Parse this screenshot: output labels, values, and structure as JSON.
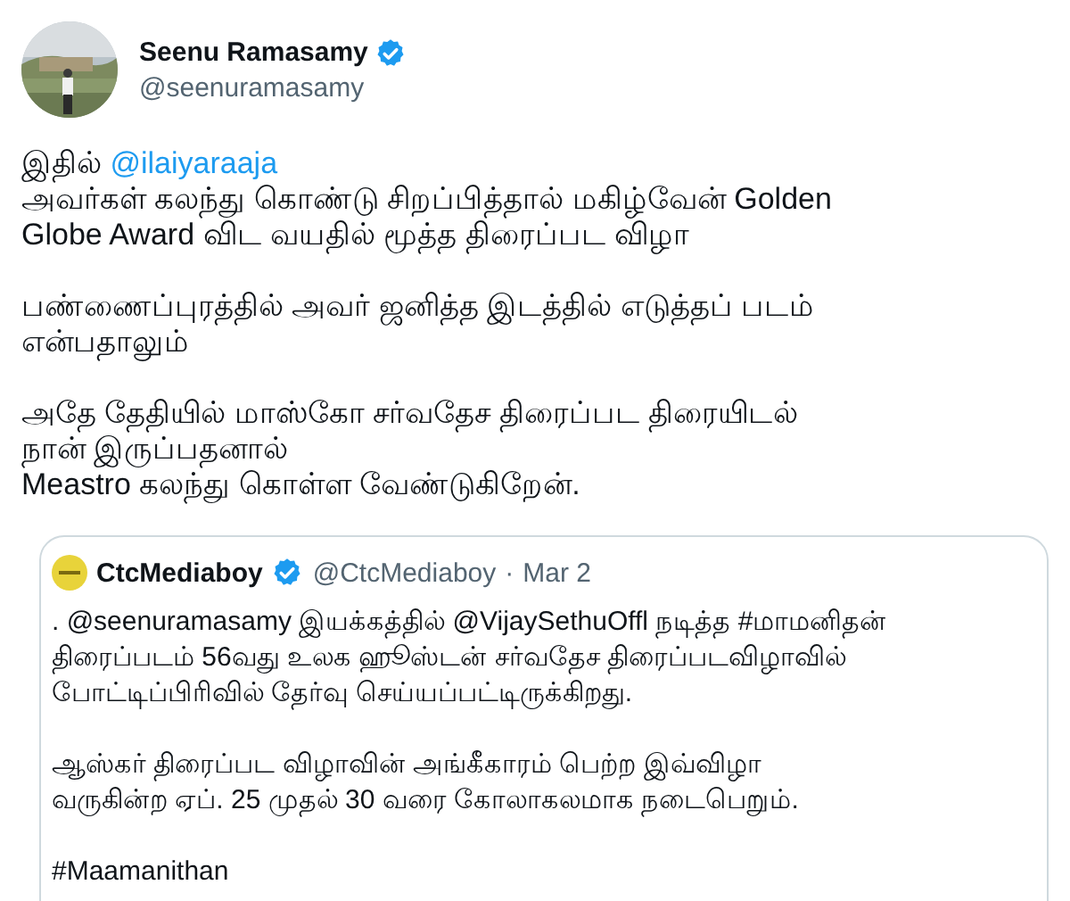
{
  "author": {
    "name": "Seenu Ramasamy",
    "handle": "@seenuramasamy",
    "verified": true
  },
  "body": [
    [
      [
        {
          "kind": "text",
          "text": "இதில் "
        },
        {
          "kind": "mention",
          "text": "@ilaiyaraaja"
        }
      ],
      [
        {
          "kind": "text",
          "text": "அவர்கள் கலந்து கொண்டு சிறப்பித்தால் மகிழ்வேன் Golden"
        }
      ],
      [
        {
          "kind": "text",
          "text": "Globe Award விட வயதில் மூத்த திரைப்பட விழா"
        }
      ]
    ],
    [
      [
        {
          "kind": "text",
          "text": "பண்ணைப்புரத்தில் அவர் ஜனித்த இடத்தில் எடுத்தப் படம்"
        }
      ],
      [
        {
          "kind": "text",
          "text": "என்பதாலும்"
        }
      ]
    ],
    [
      [
        {
          "kind": "text",
          "text": "அதே தேதியில் மாஸ்கோ சர்வதேச திரைப்பட திரையிடல்"
        }
      ],
      [
        {
          "kind": "text",
          "text": "நான் இருப்பதனால்"
        }
      ],
      [
        {
          "kind": "text",
          "text": "Meastro கலந்து கொள்ள வேண்டுகிறேன்."
        }
      ]
    ]
  ],
  "quote": {
    "name": "CtcMediaboy",
    "verified": true,
    "handle": "@CtcMediaboy",
    "separator": "·",
    "date": "Mar 2",
    "body": [
      [
        ". @seenuramasamy இயக்கத்தில் @VijaySethuOffl நடித்த #மாமனிதன்",
        "திரைப்படம் 56வது உலக ஹூஸ்டன் சர்வதேச திரைப்படவிழாவில்",
        "போட்டிப்பிரிவில் தேர்வு செய்யப்பட்டிருக்கிறது."
      ],
      [
        "ஆஸ்கர் திரைப்பட விழாவின் அங்கீகாரம் பெற்ற இவ்விழா",
        "வருகின்ற ஏப். 25 முதல் 30 வரை கோலாகலமாக நடைபெறும்."
      ],
      [
        "#Maamanithan"
      ]
    ]
  }
}
